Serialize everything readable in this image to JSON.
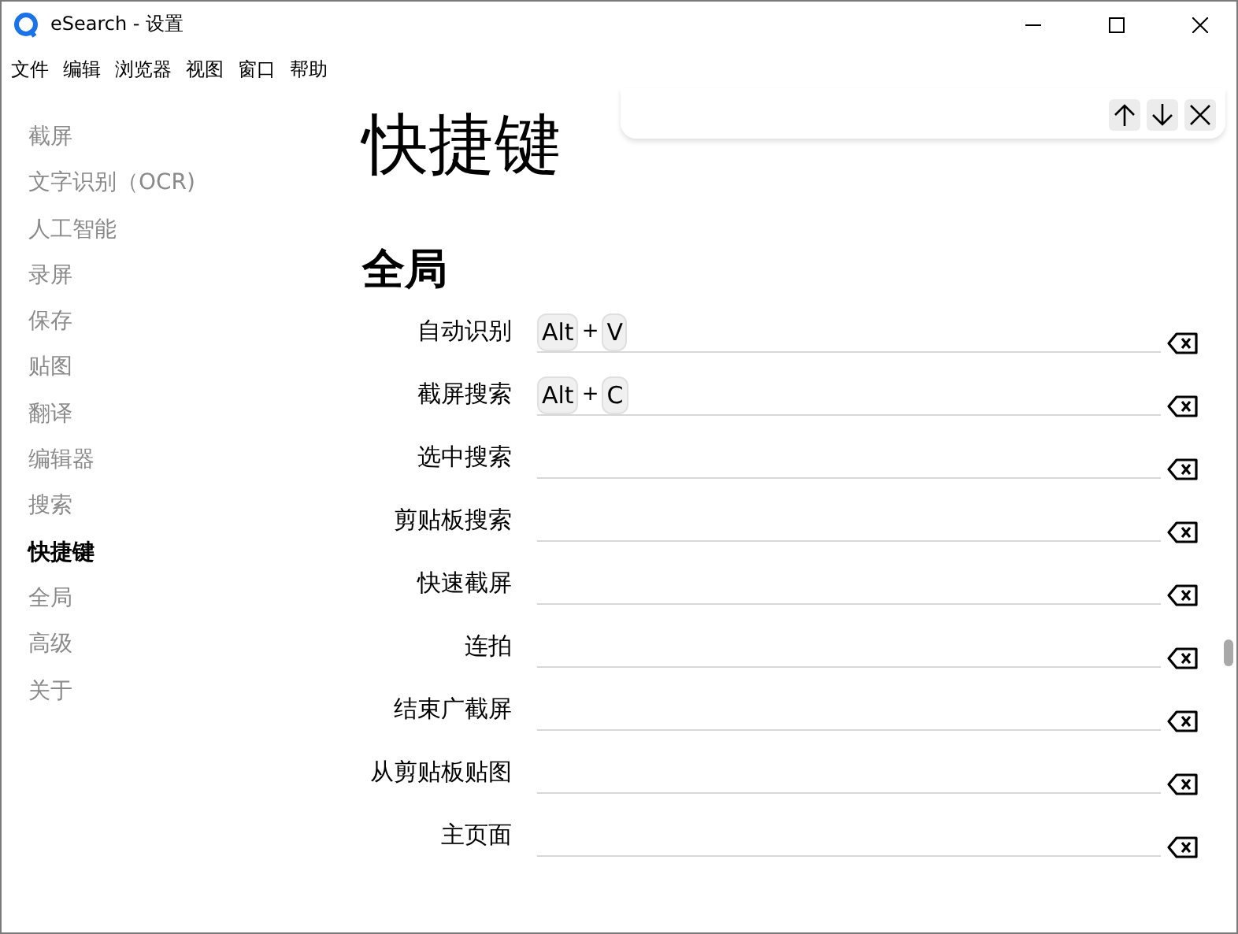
{
  "window": {
    "title": "eSearch - 设置"
  },
  "menu": [
    "文件",
    "编辑",
    "浏览器",
    "视图",
    "窗口",
    "帮助"
  ],
  "sidebar": {
    "items": [
      {
        "label": "截屏",
        "selected": false
      },
      {
        "label": "文字识别（OCR)",
        "selected": false
      },
      {
        "label": "人工智能",
        "selected": false
      },
      {
        "label": "录屏",
        "selected": false
      },
      {
        "label": "保存",
        "selected": false
      },
      {
        "label": "贴图",
        "selected": false
      },
      {
        "label": "翻译",
        "selected": false
      },
      {
        "label": "编辑器",
        "selected": false
      },
      {
        "label": "搜索",
        "selected": false
      },
      {
        "label": "快捷键",
        "selected": true
      },
      {
        "label": "全局",
        "selected": false
      },
      {
        "label": "高级",
        "selected": false
      },
      {
        "label": "关于",
        "selected": false
      }
    ]
  },
  "page_title": "快捷键",
  "section_title": "全局",
  "shortcuts": [
    {
      "label": "自动识别",
      "parts": [
        {
          "kind": "key",
          "text": "Alt"
        },
        {
          "kind": "plus",
          "text": "+"
        },
        {
          "kind": "key",
          "text": "V"
        }
      ]
    },
    {
      "label": "截屏搜索",
      "parts": [
        {
          "kind": "key",
          "text": "Alt"
        },
        {
          "kind": "plus",
          "text": "+"
        },
        {
          "kind": "key",
          "text": "C"
        }
      ]
    },
    {
      "label": "选中搜索"
    },
    {
      "label": "剪贴板搜索"
    },
    {
      "label": "快速截屏"
    },
    {
      "label": "连拍"
    },
    {
      "label": "结束广截屏"
    },
    {
      "label": "从剪贴板贴图"
    },
    {
      "label": "主页面"
    }
  ]
}
